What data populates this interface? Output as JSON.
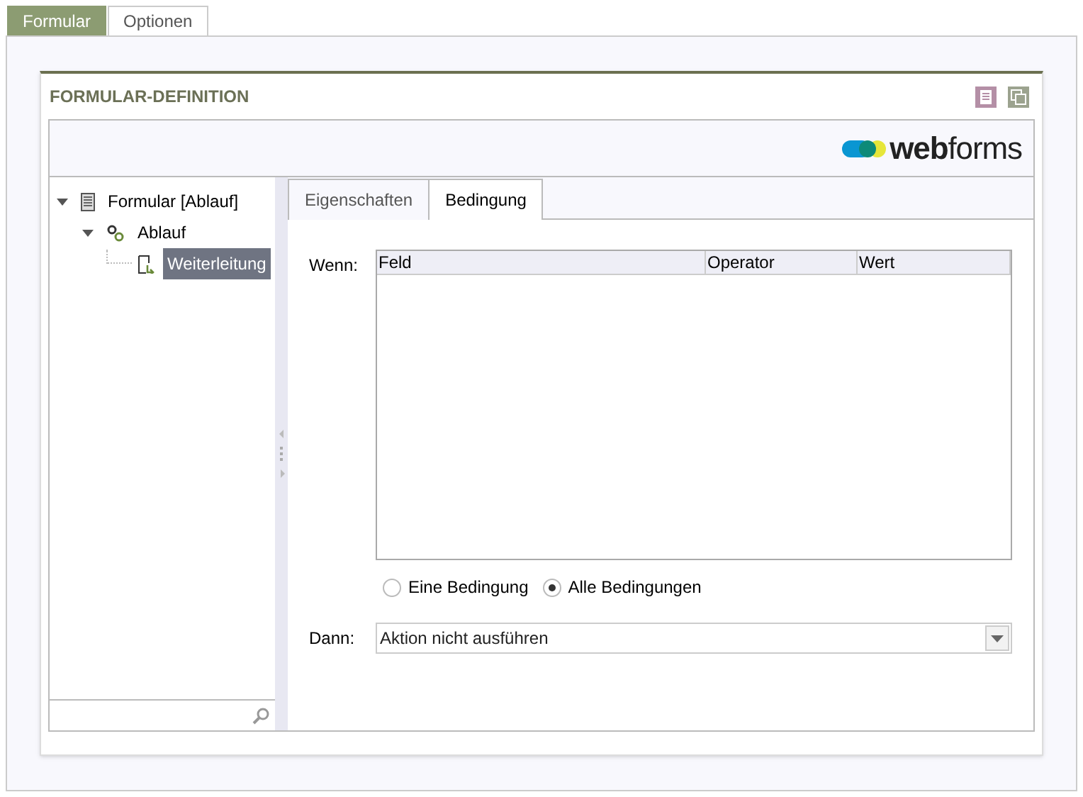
{
  "tabs": [
    {
      "label": "Formular",
      "selected": true
    },
    {
      "label": "Optionen",
      "selected": false
    }
  ],
  "panel": {
    "title": "FORMULAR-DEFINITION",
    "logo": "**web**forms"
  },
  "tree": {
    "items": [
      {
        "label": "Formular [Ablauf]",
        "kind": "form",
        "expanded": true,
        "selected": false,
        "children": [
          {
            "label": "Ablauf",
            "kind": "flow",
            "expanded": true,
            "selected": false,
            "children": [
              {
                "label": "Weiterleitung",
                "kind": "redirect",
                "selected": true
              }
            ]
          }
        ]
      }
    ]
  },
  "detail_tabs": [
    {
      "label": "Eigenschaften",
      "selected": false
    },
    {
      "label": "Bedingung",
      "selected": true
    }
  ],
  "condition": {
    "when_label": "Wenn:",
    "columns": [
      "Feld",
      "Operator",
      "Wert"
    ],
    "options": [
      {
        "label": "Eine Bedingung",
        "selected": false
      },
      {
        "label": "Alle Bedingungen",
        "selected": true
      }
    ],
    "then_label": "Dann:",
    "then_value": "Aktion nicht ausführen"
  }
}
